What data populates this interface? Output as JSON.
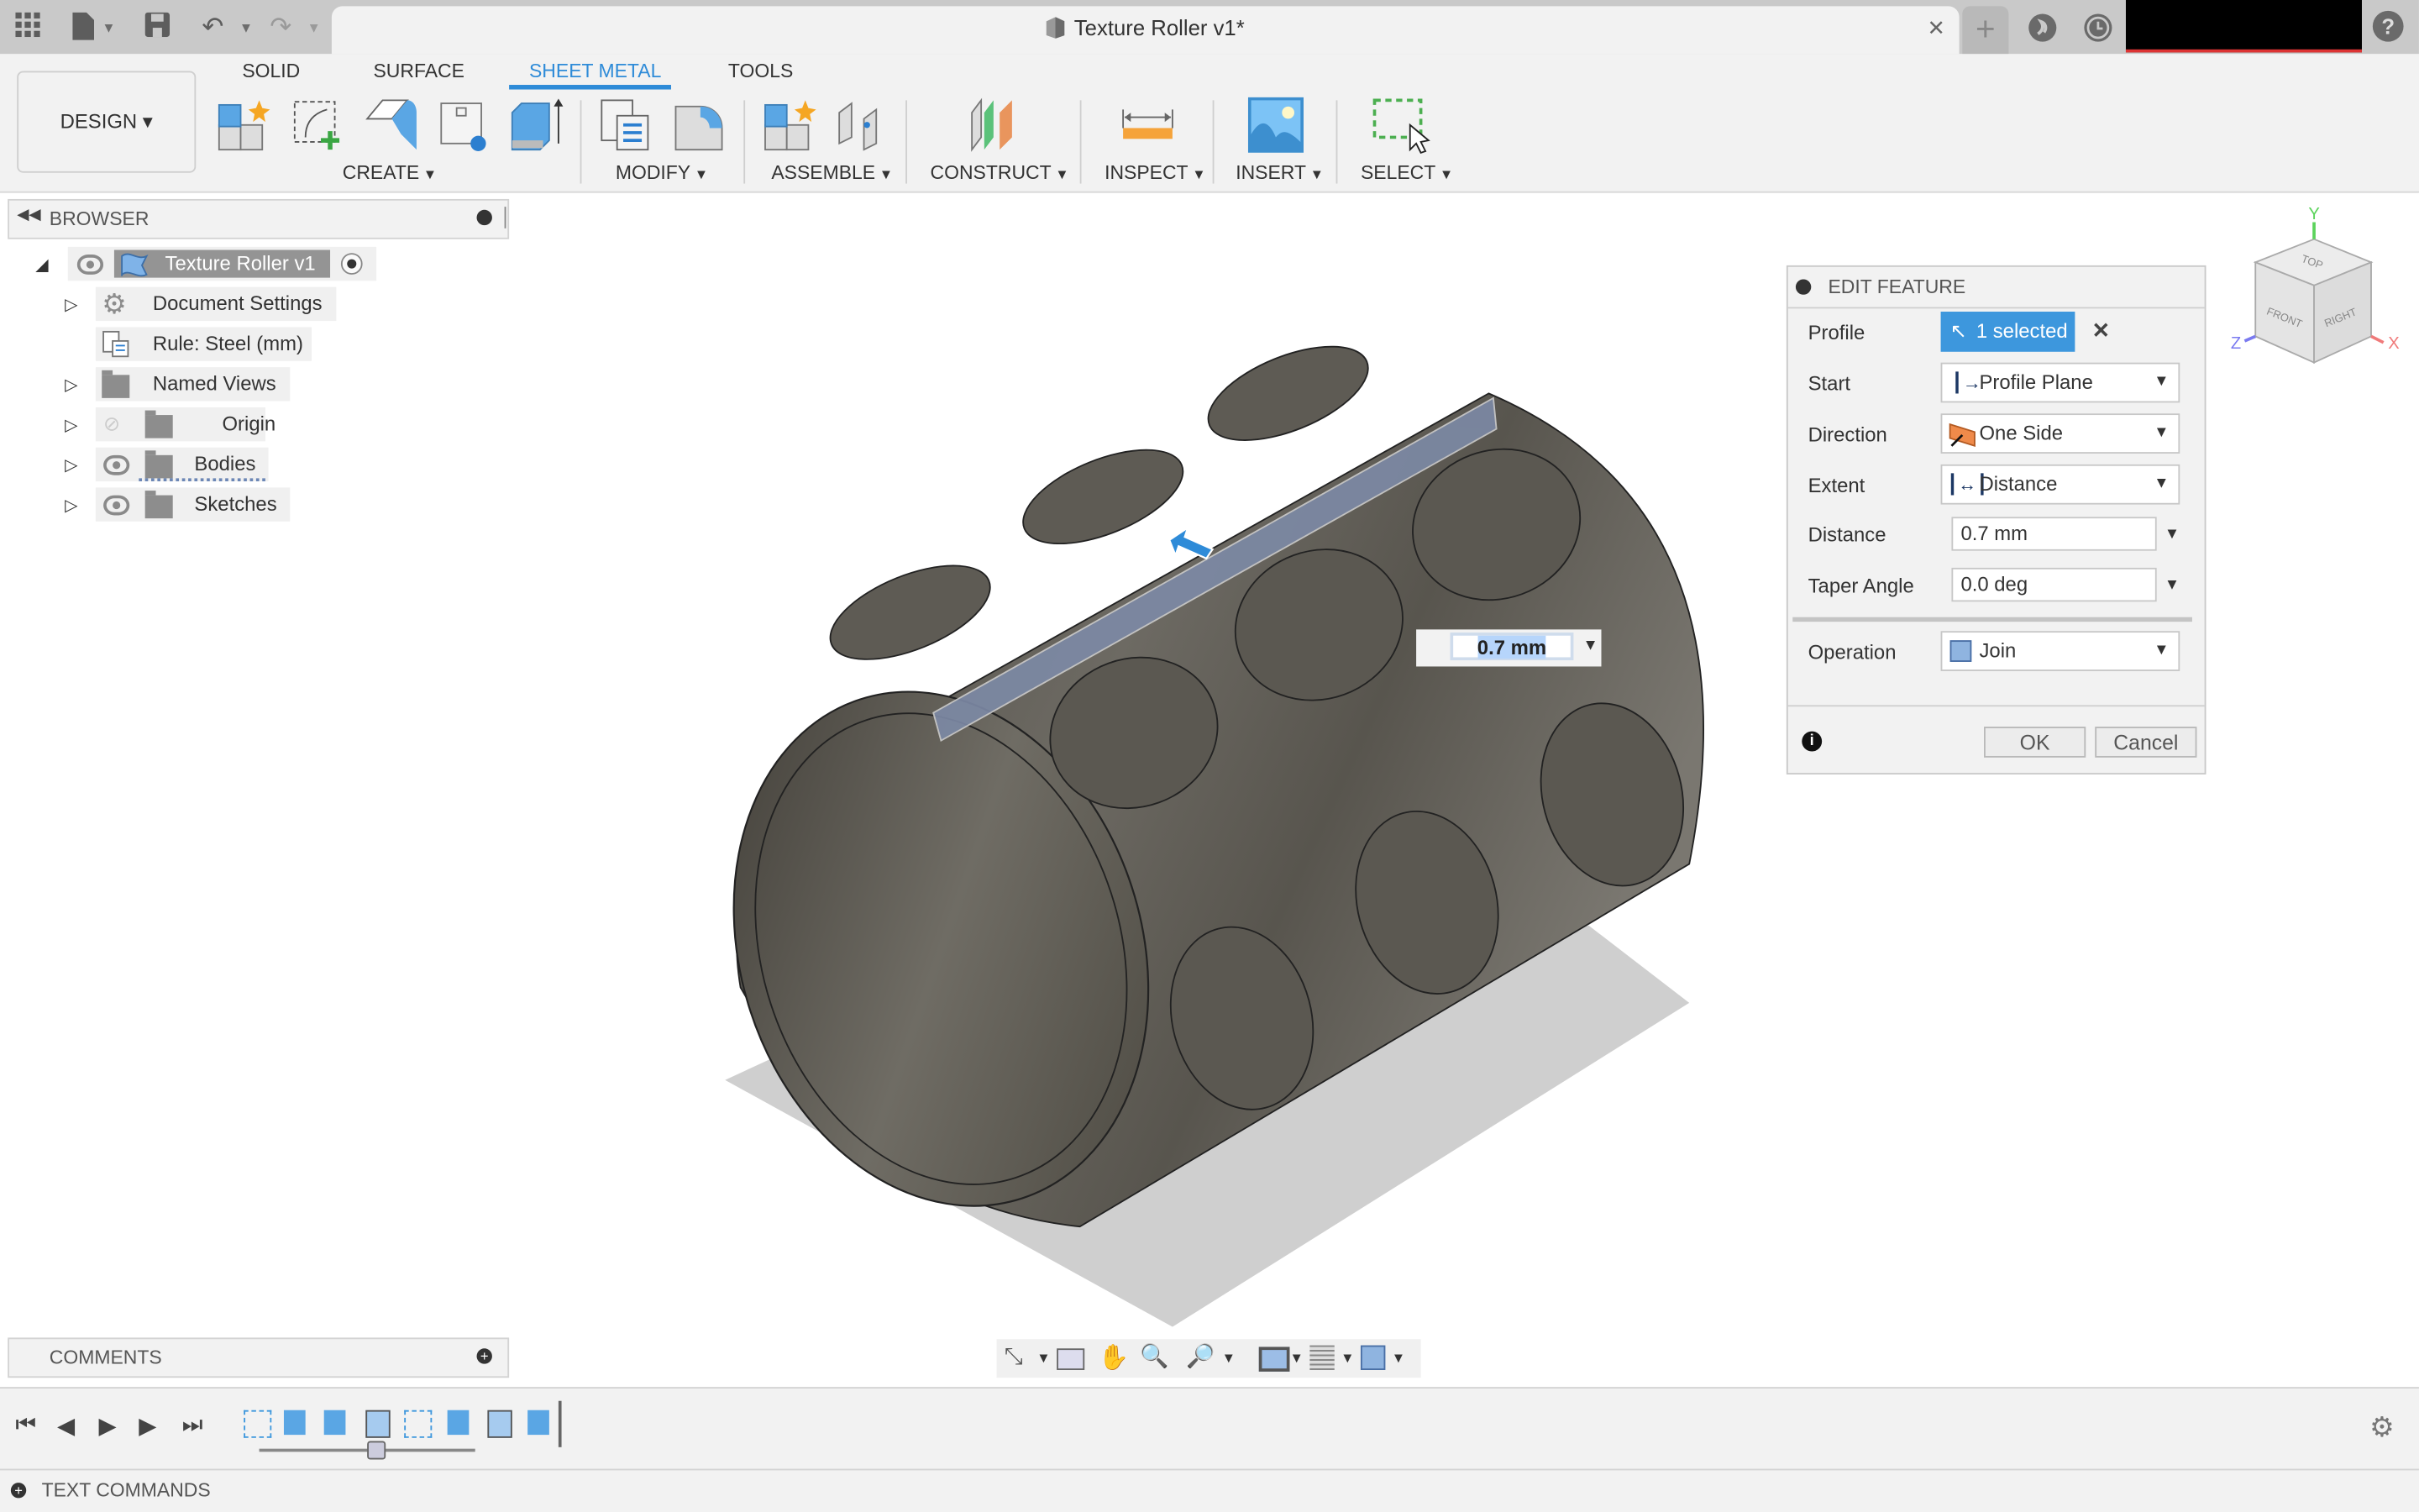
{
  "titlebar": {
    "document_title": "Texture Roller v1*",
    "icons": [
      "apps-grid-icon",
      "file-icon",
      "save-icon",
      "undo-icon",
      "redo-icon",
      "new-tab-icon",
      "extensions-icon",
      "job-status-icon",
      "help-icon"
    ],
    "close_label": "✕",
    "new_tab_label": "+",
    "help_label": "?"
  },
  "ribbon": {
    "workspace_button": "DESIGN ▾",
    "tabs": [
      {
        "label": "SOLID",
        "active": false
      },
      {
        "label": "SURFACE",
        "active": false
      },
      {
        "label": "SHEET METAL",
        "active": true
      },
      {
        "label": "TOOLS",
        "active": false
      }
    ],
    "groups": [
      "CREATE",
      "MODIFY",
      "ASSEMBLE",
      "CONSTRUCT",
      "INSPECT",
      "INSERT",
      "SELECT"
    ]
  },
  "browser": {
    "title": "BROWSER",
    "root": "Texture Roller v1",
    "items": [
      {
        "label": "Document Settings",
        "icon": "gear-icon",
        "expandable": true
      },
      {
        "label": "Rule: Steel (mm)",
        "icon": "sheet-metal-rule-icon",
        "expandable": false
      },
      {
        "label": "Named Views",
        "icon": "folder-icon",
        "expandable": true
      },
      {
        "label": "Origin",
        "icon": "folder-icon",
        "expandable": true,
        "visible": false
      },
      {
        "label": "Bodies",
        "icon": "folder-icon",
        "expandable": true,
        "visible": true
      },
      {
        "label": "Sketches",
        "icon": "folder-icon",
        "expandable": true,
        "visible": true
      }
    ]
  },
  "comments": {
    "title": "COMMENTS"
  },
  "text_commands": {
    "title": "TEXT COMMANDS"
  },
  "edit_feature": {
    "title": "EDIT FEATURE",
    "profile_label": "Profile",
    "profile_value": "1 selected",
    "start_label": "Start",
    "start_value": "Profile Plane",
    "direction_label": "Direction",
    "direction_value": "One Side",
    "extent_label": "Extent",
    "extent_value": "Distance",
    "distance_label": "Distance",
    "distance_value": "0.7 mm",
    "taper_label": "Taper Angle",
    "taper_value": "0.0 deg",
    "operation_label": "Operation",
    "operation_value": "Join",
    "ok_label": "OK",
    "cancel_label": "Cancel",
    "accent_color": "#3d97dd"
  },
  "viewport": {
    "distance_manipulator_value": "0.7 mm",
    "viewcube": {
      "top": "TOP",
      "front": "FRONT",
      "right": "RIGHT",
      "x": "X",
      "y": "Y",
      "z": "Z"
    }
  },
  "timeline": {
    "controls": [
      "first-icon",
      "previous-icon",
      "play-icon",
      "next-icon",
      "last-icon"
    ],
    "features": [
      "sketch",
      "flange",
      "extrude",
      "unfold",
      "sketch",
      "extrude",
      "refold",
      "extrude"
    ]
  }
}
